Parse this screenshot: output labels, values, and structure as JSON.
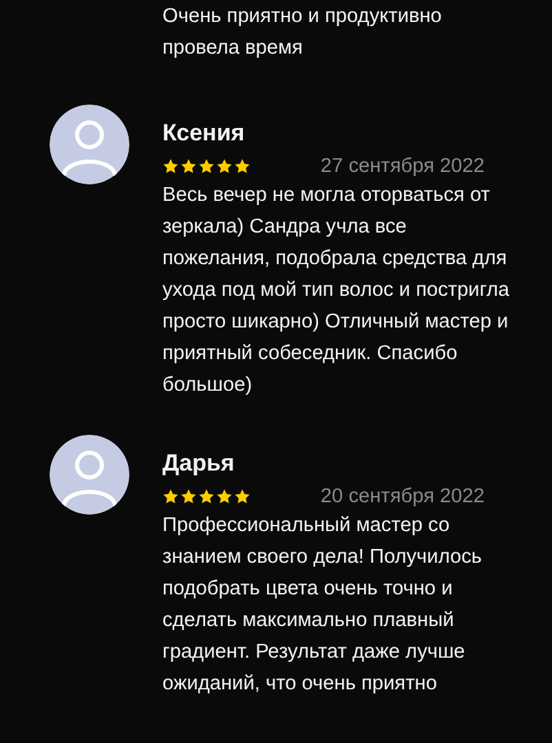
{
  "previous_review_tail": "Очень приятно и продуктивно провела время",
  "reviews": [
    {
      "author": "Ксения",
      "stars": 5,
      "date": "27 сентября 2022",
      "text": "Весь вечер не могла оторваться от зеркала) Сандра учла все пожелания, подобрала средства для ухода под мой тип волос и постригла просто шикарно) Отличный мастер и приятный собеседник. Спасибо большое)"
    },
    {
      "author": "Дарья",
      "stars": 5,
      "date": "20 сентября 2022",
      "text": "Профессиональный мастер со знанием своего дела! Получилось подобрать цвета очень точно и сделать максимально плавный градиент. Результат даже лучше ожиданий, что очень приятно"
    }
  ]
}
